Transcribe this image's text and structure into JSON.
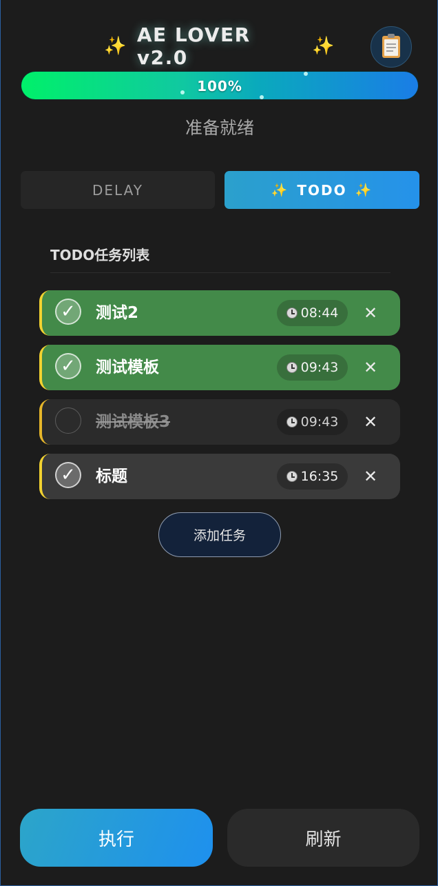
{
  "header": {
    "sparkle_left": "✨",
    "title": "AE LOVER v2.0",
    "sparkle_right": "✨",
    "clipboard_icon": "clipboard-icon"
  },
  "progress": {
    "label": "100%",
    "value": 100
  },
  "status": {
    "text": "准备就绪"
  },
  "tabs": {
    "delay": {
      "label": "DELAY"
    },
    "todo": {
      "sparkle": "✨",
      "label": "TODO"
    }
  },
  "todo": {
    "list_title": "TODO任务列表",
    "items": [
      {
        "text": "测试2",
        "time": "08:44",
        "checked": true,
        "check_mark": "✓",
        "delete": "✕"
      },
      {
        "text": "测试模板",
        "time": "09:43",
        "checked": true,
        "check_mark": "✓",
        "delete": "✕"
      },
      {
        "text": "测试模板3",
        "time": "09:43",
        "checked": false,
        "check_mark": "",
        "delete": "✕"
      },
      {
        "text": "标题",
        "time": "16:35",
        "checked": true,
        "check_mark": "✓",
        "delete": "✕"
      }
    ],
    "add_button": "添加任务"
  },
  "footer": {
    "execute_label": "执行",
    "refresh_label": "刷新"
  },
  "colors": {
    "background": "#1c1c1c",
    "accent_blue": "#2592ea",
    "progress_start": "#00f06a",
    "progress_end": "#1a7de6",
    "done_item": "#438a49",
    "pending_item": "#2b2b2b",
    "item_stripe": "#f2d230"
  }
}
